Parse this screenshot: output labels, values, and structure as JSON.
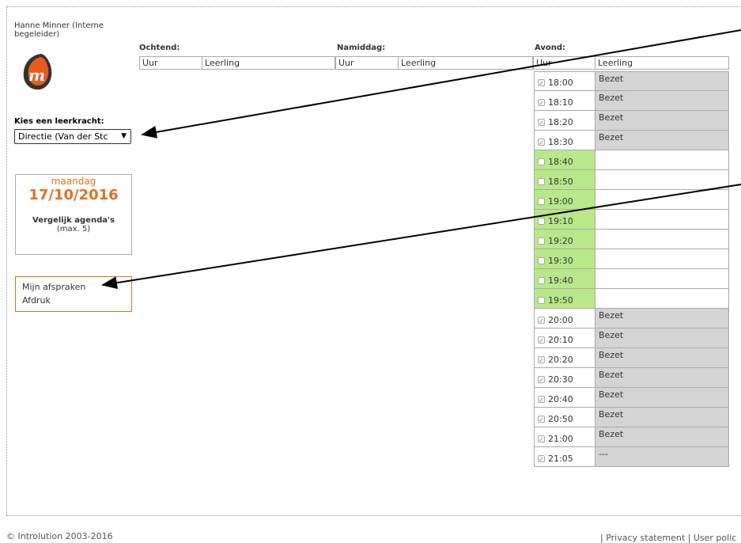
{
  "user": {
    "name": "Hanne Minner (Interne begeleider)"
  },
  "teacher_select": {
    "label": "Kies een leerkracht:",
    "selected": "Directie (Van der Stc"
  },
  "date_box": {
    "day": "maandag",
    "date": "17/10/2016",
    "compare_label": "Vergelijk agenda's",
    "compare_max": "(max. 5)"
  },
  "links": {
    "my_appointments": "Mijn afspraken",
    "print": "Afdruk"
  },
  "schedule": {
    "morning": {
      "title": "Ochtend:",
      "col_time": "Uur",
      "col_student": "Leerling"
    },
    "afternoon": {
      "title": "Namiddag:",
      "col_time": "Uur",
      "col_student": "Leerling"
    },
    "evening": {
      "title": "Avond:",
      "col_time": "Uur",
      "col_student": "Leerling",
      "slots": [
        {
          "time": "18:00",
          "status": "Bezet",
          "busy": true
        },
        {
          "time": "18:10",
          "status": "Bezet",
          "busy": true
        },
        {
          "time": "18:20",
          "status": "Bezet",
          "busy": true
        },
        {
          "time": "18:30",
          "status": "Bezet",
          "busy": true
        },
        {
          "time": "18:40",
          "status": "",
          "busy": false
        },
        {
          "time": "18:50",
          "status": "",
          "busy": false
        },
        {
          "time": "19:00",
          "status": "",
          "busy": false
        },
        {
          "time": "19:10",
          "status": "",
          "busy": false
        },
        {
          "time": "19:20",
          "status": "",
          "busy": false
        },
        {
          "time": "19:30",
          "status": "",
          "busy": false
        },
        {
          "time": "19:40",
          "status": "",
          "busy": false
        },
        {
          "time": "19:50",
          "status": "",
          "busy": false
        },
        {
          "time": "20:00",
          "status": "Bezet",
          "busy": true
        },
        {
          "time": "20:10",
          "status": "Bezet",
          "busy": true
        },
        {
          "time": "20:20",
          "status": "Bezet",
          "busy": true
        },
        {
          "time": "20:30",
          "status": "Bezet",
          "busy": true
        },
        {
          "time": "20:40",
          "status": "Bezet",
          "busy": true
        },
        {
          "time": "20:50",
          "status": "Bezet",
          "busy": true
        },
        {
          "time": "21:00",
          "status": "Bezet",
          "busy": true
        },
        {
          "time": "21:05",
          "status": "---",
          "busy": true
        }
      ]
    }
  },
  "footer": {
    "copyright": "© Introlution 2003-2016",
    "links": "| Privacy statement | User polic"
  },
  "colors": {
    "accent": "#e07020",
    "free_slot": "#b8e88a",
    "busy_cell": "#d4d4d4"
  }
}
